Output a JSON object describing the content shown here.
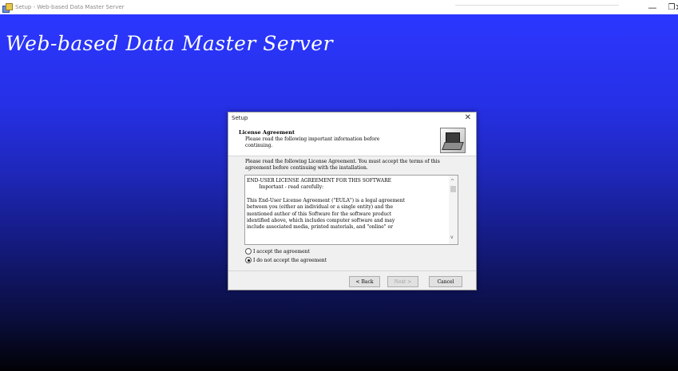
{
  "window": {
    "title": "Setup - Web-based Data Master Server",
    "controls": {
      "minimize": "—",
      "maximize": "❐",
      "close": "✕"
    }
  },
  "banner": {
    "title": "Web-based Data Master Server"
  },
  "dialog": {
    "title": "Setup",
    "close": "✕",
    "header_title": "License Agreement",
    "header_subtitle": "Please read the following important information before continuing.",
    "intro": "Please read the following License Agreement. You must accept the terms of this agreement before continuing with the installation.",
    "eula_lines": [
      "END-USER LICENSE AGREEMENT FOR THIS SOFTWARE",
      "        Important - read carefully:",
      "",
      "This End-User License Agreement (\"EULA\") is a legal agreement",
      "between you (either an individual or a single entity) and the",
      "mentioned author of this Software for the software product",
      "identified above, which includes computer software and may",
      "include associated media, printed materials, and \"online\" or"
    ],
    "radio_accept": "I accept the agreement",
    "radio_decline": "I do not accept the agreement",
    "radio_selected": "decline",
    "back_button": "< Back",
    "next_button": "Next >",
    "cancel_button": "Cancel",
    "scroll_up": "^",
    "scroll_down": "v"
  },
  "colors": {
    "banner_top": "#2b37ff",
    "banner_bottom": "#020206",
    "dialog_bg": "#f0f0f0"
  }
}
